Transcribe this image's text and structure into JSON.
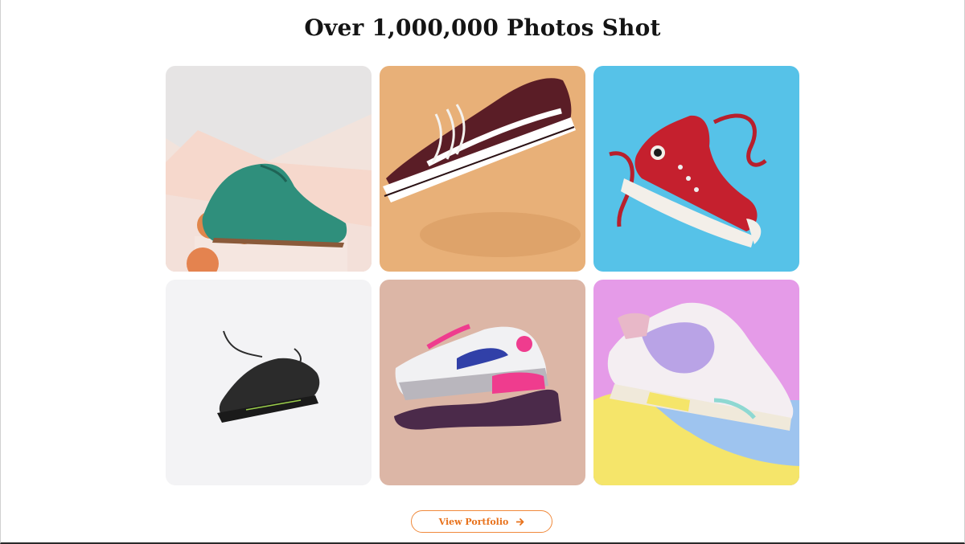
{
  "section": {
    "title": "Over 1,000,000 Photos Shot"
  },
  "gallery": {
    "photos": [
      {
        "subject": "green suede brogue shoe on peaches",
        "background": "#f1e1da",
        "accent": "#2f8f7c"
      },
      {
        "subject": "maroon skate sneaker",
        "background": "#e6ae72",
        "accent": "#5a1d26"
      },
      {
        "subject": "red high-top canvas sneaker",
        "background": "#56c2e8",
        "accent": "#c5202e"
      },
      {
        "subject": "black running sneaker",
        "background": "#f4f4f6",
        "accent": "#2b2b2b"
      },
      {
        "subject": "pink and blue air sneaker on hand",
        "background": "#dcb6a6",
        "accent": "#ef3c8e"
      },
      {
        "subject": "pastel colored sneaker",
        "background": "#e59be8",
        "accent": "#b9a3e6"
      }
    ]
  },
  "portfolio_button": {
    "label": "View Portfolio",
    "icon": "arrow-right-icon",
    "color": "#e8721c"
  }
}
